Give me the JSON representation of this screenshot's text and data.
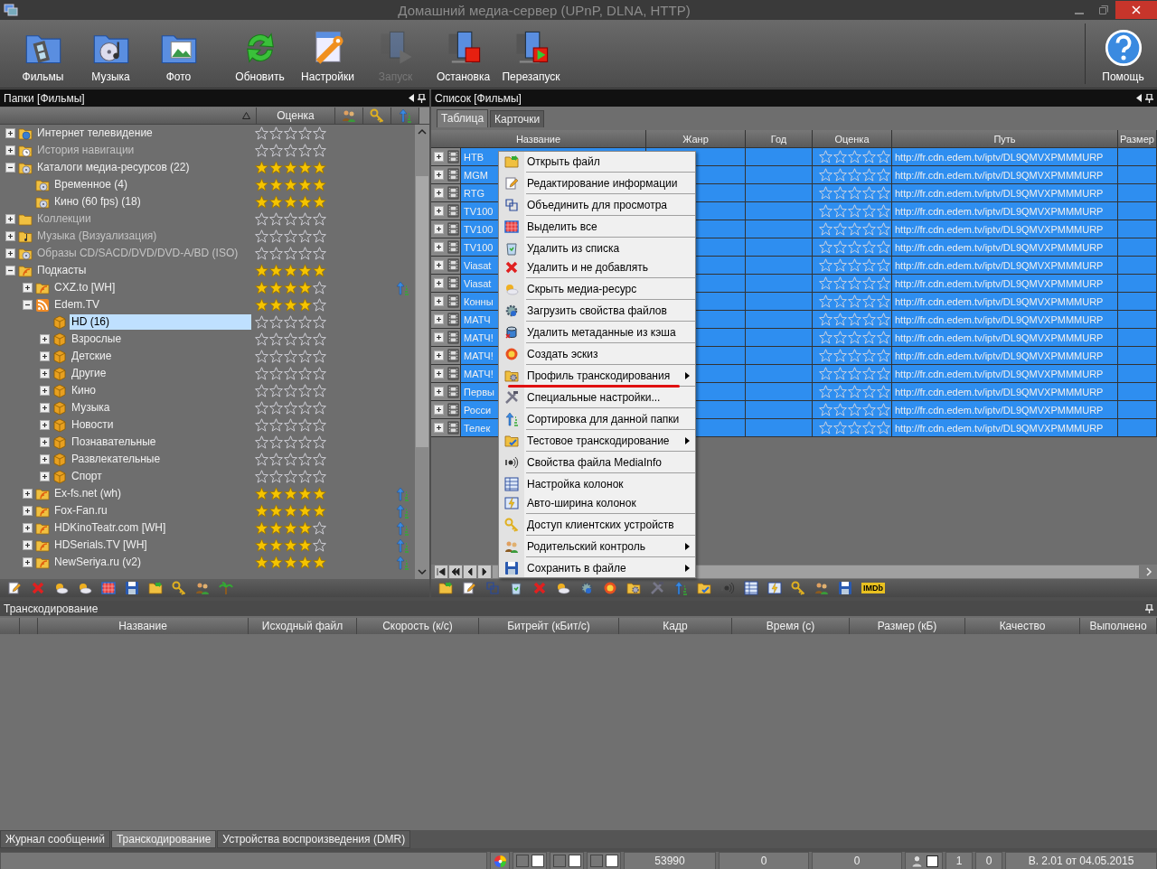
{
  "window": {
    "title": "Домашний медиа-сервер (UPnP, DLNA, HTTP)"
  },
  "toolbar": [
    {
      "label": "Фильмы",
      "disabled": false
    },
    {
      "label": "Музыка",
      "disabled": false
    },
    {
      "label": "Фото",
      "disabled": false
    },
    {
      "label": "Обновить",
      "disabled": false
    },
    {
      "label": "Настройки",
      "disabled": false
    },
    {
      "label": "Запуск",
      "disabled": true
    },
    {
      "label": "Остановка",
      "disabled": false
    },
    {
      "label": "Перезапуск",
      "disabled": false
    }
  ],
  "help_button": {
    "label": "Помощь"
  },
  "folders_panel": {
    "title": "Папки [Фильмы]",
    "rating_column": "Оценка",
    "tree": [
      {
        "label": "Интернет телевидение",
        "kind": "globe",
        "stars": 0,
        "selected": false,
        "disabled": false,
        "sort_icon": false,
        "expanded": false
      },
      {
        "label": "История навигации",
        "kind": "history",
        "stars": 0,
        "selected": false,
        "disabled": true,
        "sort_icon": false,
        "expanded": false
      },
      {
        "label": "Каталоги медиа-ресурсов (22)",
        "kind": "catalog",
        "stars": 5,
        "selected": false,
        "disabled": false,
        "sort_icon": false,
        "expanded": true,
        "children": [
          {
            "label": "Временное (4)",
            "kind": "catalog",
            "stars": 5,
            "selected": false,
            "disabled": false,
            "sort_icon": false
          },
          {
            "label": "Кино (60 fps) (18)",
            "kind": "catalog",
            "stars": 5,
            "selected": false,
            "disabled": false,
            "sort_icon": false
          }
        ]
      },
      {
        "label": "Коллекции",
        "kind": "collection",
        "stars": 0,
        "selected": false,
        "disabled": true,
        "sort_icon": false,
        "expanded": false
      },
      {
        "label": "Музыка (Визуализация)",
        "kind": "music",
        "stars": 0,
        "selected": false,
        "disabled": true,
        "sort_icon": false,
        "expanded": false
      },
      {
        "label": "Образы CD/SACD/DVD/DVD-A/BD (ISO)",
        "kind": "disc",
        "stars": 0,
        "selected": false,
        "disabled": true,
        "sort_icon": false,
        "expanded": false
      },
      {
        "label": "Подкасты",
        "kind": "podcast",
        "stars": 5,
        "selected": false,
        "disabled": false,
        "sort_icon": false,
        "expanded": true,
        "children": [
          {
            "label": "CXZ.to [WH]",
            "kind": "podcast",
            "stars": 4,
            "selected": false,
            "disabled": false,
            "sort_icon": true,
            "expanded": false
          },
          {
            "label": "Edem.TV",
            "kind": "feed",
            "stars": 4,
            "selected": false,
            "disabled": false,
            "sort_icon": false,
            "expanded": true,
            "children": [
              {
                "label": "HD (16)",
                "kind": "category",
                "stars": 0,
                "selected": true,
                "disabled": false,
                "sort_icon": false
              },
              {
                "label": "Взрослые",
                "kind": "category",
                "stars": 0,
                "selected": false,
                "disabled": false,
                "sort_icon": false,
                "expanded": false
              },
              {
                "label": "Детские",
                "kind": "category",
                "stars": 0,
                "selected": false,
                "disabled": false,
                "sort_icon": false,
                "expanded": false
              },
              {
                "label": "Другие",
                "kind": "category",
                "stars": 0,
                "selected": false,
                "disabled": false,
                "sort_icon": false,
                "expanded": false
              },
              {
                "label": "Кино",
                "kind": "category",
                "stars": 0,
                "selected": false,
                "disabled": false,
                "sort_icon": false,
                "expanded": false
              },
              {
                "label": "Музыка",
                "kind": "category",
                "stars": 0,
                "selected": false,
                "disabled": false,
                "sort_icon": false,
                "expanded": false
              },
              {
                "label": "Новости",
                "kind": "category",
                "stars": 0,
                "selected": false,
                "disabled": false,
                "sort_icon": false,
                "expanded": false
              },
              {
                "label": "Познавательные",
                "kind": "category",
                "stars": 0,
                "selected": false,
                "disabled": false,
                "sort_icon": false,
                "expanded": false
              },
              {
                "label": "Развлекательные",
                "kind": "category",
                "stars": 0,
                "selected": false,
                "disabled": false,
                "sort_icon": false,
                "expanded": false
              },
              {
                "label": "Спорт",
                "kind": "category",
                "stars": 0,
                "selected": false,
                "disabled": false,
                "sort_icon": false,
                "expanded": false
              }
            ]
          },
          {
            "label": "Ex-fs.net (wh)",
            "kind": "podcast",
            "stars": 5,
            "selected": false,
            "disabled": false,
            "sort_icon": true,
            "expanded": false
          },
          {
            "label": "Fox-Fan.ru",
            "kind": "podcast",
            "stars": 5,
            "selected": false,
            "disabled": false,
            "sort_icon": true,
            "expanded": false
          },
          {
            "label": "HDKinoTeatr.com [WH]",
            "kind": "podcast",
            "stars": 4,
            "selected": false,
            "disabled": false,
            "sort_icon": true,
            "expanded": false
          },
          {
            "label": "HDSerials.TV [WH]",
            "kind": "podcast",
            "stars": 4,
            "selected": false,
            "disabled": false,
            "sort_icon": true,
            "expanded": false
          },
          {
            "label": "NewSeriya.ru (v2)",
            "kind": "podcast",
            "stars": 5,
            "selected": false,
            "disabled": false,
            "sort_icon": true,
            "expanded": false
          }
        ]
      }
    ]
  },
  "list_panel": {
    "title": "Список [Фильмы]",
    "tabs": [
      {
        "label": "Таблица",
        "selected": true
      },
      {
        "label": "Карточки",
        "selected": false
      }
    ],
    "columns": [
      "Название",
      "Жанр",
      "Год",
      "Оценка",
      "Путь",
      "Размер"
    ],
    "rows": [
      {
        "name": "НТВ",
        "stars": 0,
        "path": "http://fr.cdn.edem.tv/iptv/DL9QMVXPMMMURP",
        "selected": true,
        "expanded": false
      },
      {
        "name": "MGM",
        "stars": 0,
        "path": "http://fr.cdn.edem.tv/iptv/DL9QMVXPMMMURP",
        "selected": true,
        "expanded": false
      },
      {
        "name": "RTG",
        "stars": 0,
        "path": "http://fr.cdn.edem.tv/iptv/DL9QMVXPMMMURP",
        "selected": true,
        "expanded": false
      },
      {
        "name": "TV100",
        "stars": 0,
        "path": "http://fr.cdn.edem.tv/iptv/DL9QMVXPMMMURP",
        "selected": true,
        "expanded": false
      },
      {
        "name": "TV100",
        "stars": 0,
        "path": "http://fr.cdn.edem.tv/iptv/DL9QMVXPMMMURP",
        "selected": true,
        "expanded": false
      },
      {
        "name": "TV100",
        "stars": 0,
        "path": "http://fr.cdn.edem.tv/iptv/DL9QMVXPMMMURP",
        "selected": true,
        "expanded": false
      },
      {
        "name": "Viasat",
        "stars": 0,
        "path": "http://fr.cdn.edem.tv/iptv/DL9QMVXPMMMURP",
        "selected": true,
        "expanded": false
      },
      {
        "name": "Viasat",
        "stars": 0,
        "path": "http://fr.cdn.edem.tv/iptv/DL9QMVXPMMMURP",
        "selected": true,
        "expanded": false
      },
      {
        "name": "Конны",
        "stars": 0,
        "path": "http://fr.cdn.edem.tv/iptv/DL9QMVXPMMMURP",
        "selected": true,
        "expanded": false
      },
      {
        "name": "МАТЧ",
        "stars": 0,
        "path": "http://fr.cdn.edem.tv/iptv/DL9QMVXPMMMURP",
        "selected": true,
        "expanded": false
      },
      {
        "name": "МАТЧ!",
        "stars": 0,
        "path": "http://fr.cdn.edem.tv/iptv/DL9QMVXPMMMURP",
        "selected": true,
        "expanded": false
      },
      {
        "name": "МАТЧ!",
        "stars": 0,
        "path": "http://fr.cdn.edem.tv/iptv/DL9QMVXPMMMURP",
        "selected": true,
        "expanded": false
      },
      {
        "name": "МАТЧ!",
        "stars": 0,
        "path": "http://fr.cdn.edem.tv/iptv/DL9QMVXPMMMURP",
        "selected": true,
        "expanded": false
      },
      {
        "name": "Первы",
        "stars": 0,
        "path": "http://fr.cdn.edem.tv/iptv/DL9QMVXPMMMURP",
        "selected": true,
        "expanded": false
      },
      {
        "name": "Росси",
        "stars": 0,
        "path": "http://fr.cdn.edem.tv/iptv/DL9QMVXPMMMURP",
        "selected": true,
        "expanded": false
      },
      {
        "name": "Телек",
        "stars": 0,
        "path": "http://fr.cdn.edem.tv/iptv/DL9QMVXPMMMURP",
        "selected": true,
        "expanded": false
      }
    ],
    "toolbar_badge": "IMDb"
  },
  "context_menu": {
    "groups": [
      [
        {
          "label": "Открыть файл",
          "submenu": false,
          "underlined": false
        }
      ],
      [
        {
          "label": "Редактирование информации",
          "submenu": false,
          "underlined": false
        }
      ],
      [
        {
          "label": "Объединить для просмотра",
          "submenu": false,
          "underlined": false
        }
      ],
      [
        {
          "label": "Выделить все",
          "submenu": false,
          "underlined": false
        }
      ],
      [
        {
          "label": "Удалить из списка",
          "submenu": false,
          "underlined": false
        },
        {
          "label": "Удалить и не добавлять",
          "submenu": false,
          "underlined": false
        }
      ],
      [
        {
          "label": "Скрыть медиа-ресурс",
          "submenu": false,
          "underlined": false
        }
      ],
      [
        {
          "label": "Загрузить свойства файлов",
          "submenu": false,
          "underlined": false
        }
      ],
      [
        {
          "label": "Удалить метаданные из кэша",
          "submenu": false,
          "underlined": false
        }
      ],
      [
        {
          "label": "Создать эскиз",
          "submenu": false,
          "underlined": false
        }
      ],
      [
        {
          "label": "Профиль транскодирования",
          "submenu": true,
          "underlined": true
        }
      ],
      [
        {
          "label": "Специальные настройки...",
          "submenu": false,
          "underlined": false
        }
      ],
      [
        {
          "label": "Сортировка для данной папки",
          "submenu": false,
          "underlined": false
        }
      ],
      [
        {
          "label": "Тестовое транскодирование",
          "submenu": true,
          "underlined": false
        }
      ],
      [
        {
          "label": "Свойства файла MediaInfo",
          "submenu": false,
          "underlined": false
        }
      ],
      [
        {
          "label": "Настройка колонок",
          "submenu": false,
          "underlined": false
        },
        {
          "label": "Авто-ширина колонок",
          "submenu": false,
          "underlined": false
        }
      ],
      [
        {
          "label": "Доступ клиентских устройств",
          "submenu": false,
          "underlined": false
        }
      ],
      [
        {
          "label": "Родительский контроль",
          "submenu": true,
          "underlined": false
        }
      ],
      [
        {
          "label": "Сохранить в файле",
          "submenu": true,
          "underlined": false
        }
      ]
    ]
  },
  "transcoding_panel": {
    "title": "Транскодирование",
    "columns": [
      "Название",
      "Исходный файл",
      "Скорость (к/с)",
      "Битрейт (кБит/с)",
      "Кадр",
      "Время (с)",
      "Размер (кБ)",
      "Качество",
      "Выполнено"
    ]
  },
  "bottom_tabs": [
    {
      "label": "Журнал сообщений",
      "selected": false
    },
    {
      "label": "Транскодирование",
      "selected": true
    },
    {
      "label": "Устройства воспроизведения (DMR)",
      "selected": false
    }
  ],
  "status_bar": {
    "counter": "53990",
    "values": [
      "0",
      "0"
    ],
    "checked": false,
    "counts": [
      "1",
      "0"
    ],
    "version": "В. 2.01 от 04.05.2015"
  }
}
